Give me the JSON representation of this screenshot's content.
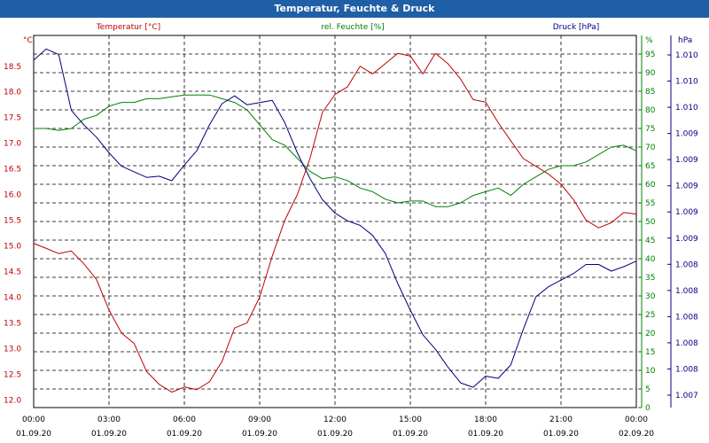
{
  "window": {
    "title": "Temperatur, Feuchte & Druck"
  },
  "chart_data": {
    "type": "line",
    "title": "Temperatur, Feuchte & Druck",
    "grid": true,
    "x": {
      "unit": "time",
      "range": [
        "01.09.20 00:00",
        "02.09.20 00:00"
      ],
      "tick_labels": [
        {
          "time": "00:00",
          "date": "01.09.20"
        },
        {
          "time": "03:00",
          "date": "01.09.20"
        },
        {
          "time": "06:00",
          "date": "01.09.20"
        },
        {
          "time": "09:00",
          "date": "01.09.20"
        },
        {
          "time": "12:00",
          "date": "01.09.20"
        },
        {
          "time": "15:00",
          "date": "01.09.20"
        },
        {
          "time": "18:00",
          "date": "01.09.20"
        },
        {
          "time": "21:00",
          "date": "01.09.20"
        },
        {
          "time": "00:00",
          "date": "02.09.20"
        }
      ]
    },
    "axes": {
      "left": {
        "label": "Temperatur [°C]",
        "unit": "°C",
        "color": "#c00000",
        "range": [
          11.85,
          19.1
        ],
        "ticks": [
          "12.0",
          "12.5",
          "13.0",
          "13.5",
          "14.0",
          "14.5",
          "15.0",
          "15.5",
          "16.0",
          "16.5",
          "17.0",
          "17.5",
          "18.0",
          "18.5"
        ]
      },
      "middle": {
        "label": "rel. Feuchte [%]",
        "unit": "%",
        "color": "#008000",
        "range": [
          0,
          100
        ],
        "ticks": [
          "0",
          "5",
          "10",
          "15",
          "20",
          "25",
          "30",
          "35",
          "40",
          "45",
          "50",
          "55",
          "60",
          "65",
          "70",
          "75",
          "80",
          "85",
          "90",
          "95"
        ]
      },
      "right": {
        "label": "Druck [hPa]",
        "unit": "hPa",
        "color": "#000080",
        "ticks": [
          "1.007",
          "1.008",
          "1.008",
          "1.008",
          "1.008",
          "1.008",
          "1.009",
          "1.009",
          "1.009",
          "1.009",
          "1.009",
          "1.010",
          "1.010",
          "1.010"
        ]
      }
    },
    "series": [
      {
        "name": "Temperatur [°C]",
        "axis": "left",
        "color": "#c00000",
        "x": [
          "00:00",
          "00:30",
          "01:00",
          "01:30",
          "02:00",
          "02:30",
          "03:00",
          "03:30",
          "04:00",
          "04:30",
          "05:00",
          "05:30",
          "06:00",
          "06:30",
          "07:00",
          "07:30",
          "08:00",
          "08:30",
          "09:00",
          "09:30",
          "10:00",
          "10:30",
          "11:00",
          "11:30",
          "12:00",
          "12:30",
          "13:00",
          "13:30",
          "14:00",
          "14:30",
          "15:00",
          "15:30",
          "16:00",
          "16:30",
          "17:00",
          "17:30",
          "18:00",
          "18:30",
          "19:00",
          "19:30",
          "20:00",
          "20:30",
          "21:00",
          "21:30",
          "22:00",
          "22:30",
          "23:00",
          "23:30",
          "24:00"
        ],
        "values": [
          15.05,
          14.95,
          14.85,
          14.9,
          14.65,
          14.35,
          13.75,
          13.3,
          13.1,
          12.55,
          12.3,
          12.15,
          12.25,
          12.2,
          12.35,
          12.75,
          13.4,
          13.5,
          14.0,
          14.8,
          15.5,
          16.0,
          16.7,
          17.6,
          17.95,
          18.1,
          18.5,
          18.35,
          18.55,
          18.75,
          18.7,
          18.35,
          18.75,
          18.55,
          18.25,
          17.85,
          17.8,
          17.4,
          17.05,
          16.7,
          16.55,
          16.4,
          16.2,
          15.9,
          15.5,
          15.35,
          15.45,
          15.65,
          15.62
        ]
      },
      {
        "name": "rel. Feuchte [%]",
        "axis": "middle",
        "color": "#008000",
        "x": [
          "00:00",
          "00:30",
          "01:00",
          "01:30",
          "02:00",
          "02:30",
          "03:00",
          "03:30",
          "04:00",
          "04:30",
          "05:00",
          "05:30",
          "06:00",
          "06:30",
          "07:00",
          "07:30",
          "08:00",
          "08:30",
          "09:00",
          "09:30",
          "10:00",
          "10:30",
          "11:00",
          "11:30",
          "12:00",
          "12:30",
          "13:00",
          "13:30",
          "14:00",
          "14:30",
          "15:00",
          "15:30",
          "16:00",
          "16:30",
          "17:00",
          "17:30",
          "18:00",
          "18:30",
          "19:00",
          "19:30",
          "20:00",
          "20:30",
          "21:00",
          "21:30",
          "22:00",
          "22:30",
          "23:00",
          "23:30",
          "24:00"
        ],
        "values": [
          75,
          75,
          74.5,
          75,
          77.5,
          78.5,
          81,
          82,
          82,
          83,
          83,
          83.5,
          84,
          84,
          84,
          83,
          82,
          80,
          76,
          72,
          70.5,
          67,
          63.5,
          61.5,
          62,
          61,
          59,
          58,
          56,
          55,
          55.5,
          55.5,
          54,
          54,
          55,
          57,
          58,
          59,
          57,
          60,
          62,
          64,
          65,
          65,
          66,
          68,
          70,
          70.5,
          69
        ]
      },
      {
        "name": "Druck [hPa]",
        "axis": "right",
        "color": "#000080",
        "x": [
          "00:00",
          "00:30",
          "01:00",
          "01:30",
          "02:00",
          "02:30",
          "03:00",
          "03:30",
          "04:00",
          "04:30",
          "05:00",
          "05:30",
          "06:00",
          "06:30",
          "07:00",
          "07:30",
          "08:00",
          "08:30",
          "09:00",
          "09:30",
          "10:00",
          "10:30",
          "11:00",
          "11:30",
          "12:00",
          "12:30",
          "13:00",
          "13:30",
          "14:00",
          "14:30",
          "15:00",
          "15:30",
          "16:00",
          "16:30",
          "17:00",
          "17:30",
          "18:00",
          "18:30",
          "19:00",
          "19:30",
          "20:00",
          "20:30",
          "21:00",
          "21:30",
          "22:00",
          "22:30",
          "23:00",
          "23:30",
          "24:00"
        ],
        "values": [
          1.00993,
          1.01003,
          1.00998,
          1.00948,
          1.00935,
          1.00924,
          1.0091,
          1.00898,
          1.00893,
          1.00888,
          1.00889,
          1.00885,
          1.00899,
          1.00912,
          1.00935,
          1.00954,
          1.00961,
          1.00953,
          1.00955,
          1.00957,
          1.00937,
          1.0091,
          1.00887,
          1.00868,
          1.00856,
          1.00849,
          1.00845,
          1.00836,
          1.0082,
          1.00793,
          1.00769,
          1.00747,
          1.00734,
          1.00718,
          1.00704,
          1.007,
          1.0071,
          1.00708,
          1.0072,
          1.00752,
          1.00781,
          1.0079,
          1.00796,
          1.00802,
          1.0081,
          1.0081,
          1.00804,
          1.00808,
          1.00813
        ]
      }
    ]
  }
}
